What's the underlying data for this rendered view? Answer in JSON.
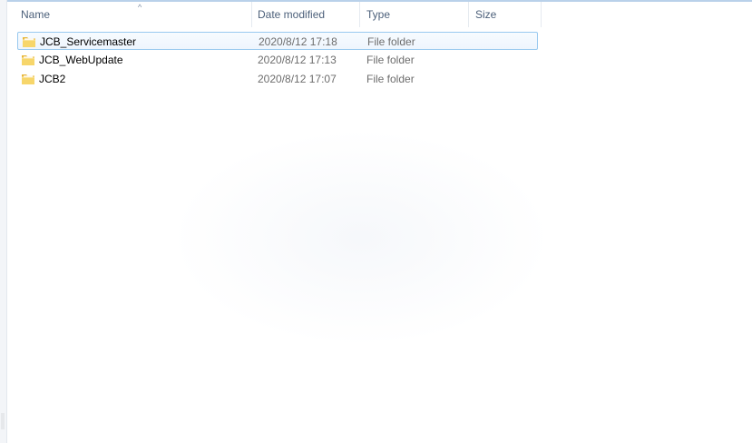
{
  "columns": {
    "name": "Name",
    "date_modified": "Date modified",
    "type": "Type",
    "size": "Size"
  },
  "sort": {
    "column": "name",
    "icon": "sort-arrow-up-icon",
    "glyph": "^"
  },
  "files": [
    {
      "name": "JCB_Servicemaster",
      "date_modified": "2020/8/12 17:18",
      "type": "File folder",
      "icon": "folder-icon",
      "selected": true
    },
    {
      "name": "JCB_WebUpdate",
      "date_modified": "2020/8/12 17:13",
      "type": "File folder",
      "icon": "folder-icon",
      "selected": false
    },
    {
      "name": "JCB2",
      "date_modified": "2020/8/12 17:07",
      "type": "File folder",
      "icon": "folder-icon",
      "selected": false
    }
  ],
  "colors": {
    "header_text": "#4c607a",
    "selection_border": "#99c9ef",
    "folder_yellow": "#f2c94c",
    "secondary_text": "#6d6d6d"
  }
}
